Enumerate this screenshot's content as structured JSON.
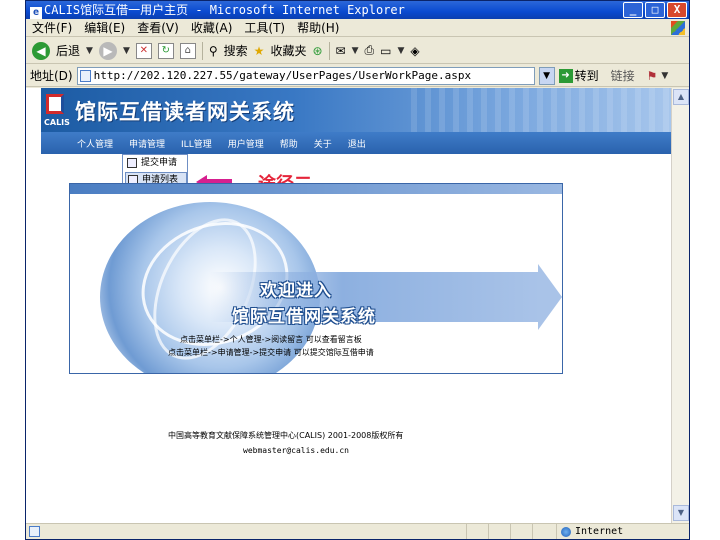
{
  "window": {
    "title": "CALIS馆际互借一用户主页 - Microsoft Internet Explorer",
    "min_label": "_",
    "max_label": "□",
    "close_label": "X"
  },
  "menubar": {
    "items": [
      "文件(F)",
      "编辑(E)",
      "查看(V)",
      "收藏(A)",
      "工具(T)",
      "帮助(H)"
    ]
  },
  "toolbar": {
    "back_label": "后退",
    "search_label": "搜索",
    "favorites_label": "收藏夹"
  },
  "addressbar": {
    "label": "地址(D)",
    "url": "http://202.120.227.55/gateway/UserPages/UserWorkPage.aspx",
    "go_label": "转到",
    "links_label": "链接"
  },
  "banner": {
    "logo_text": "CALIS",
    "title": "馆际互借读者网关系统"
  },
  "nav": {
    "items": [
      "个人管理",
      "申请管理",
      "ILL管理",
      "用户管理",
      "帮助",
      "关于",
      "退出"
    ]
  },
  "dropdown": {
    "items": [
      "提交申请",
      "申请列表"
    ],
    "selected_index": 1
  },
  "annotation": {
    "callout": "途径二",
    "color": "#d61f8f"
  },
  "welcome": {
    "line1": "欢迎进入",
    "line2": "馆际互借网关系统",
    "hint1": "点击菜单栏->个人管理->阅读留言 可以查看留言板",
    "hint2": "点击菜单栏->申请管理->提交申请 可以提交馆际互借申请"
  },
  "footer": {
    "copyright": "中国高等教育文献保障系统管理中心(CALIS) 2001-2008版权所有",
    "email": "webmaster@calis.edu.cn"
  },
  "statusbar": {
    "zone": "Internet"
  },
  "colors": {
    "banner_dark": "#1c5ba3",
    "nav_bar": "#2a62ad",
    "callout_text": "#e5253a"
  }
}
